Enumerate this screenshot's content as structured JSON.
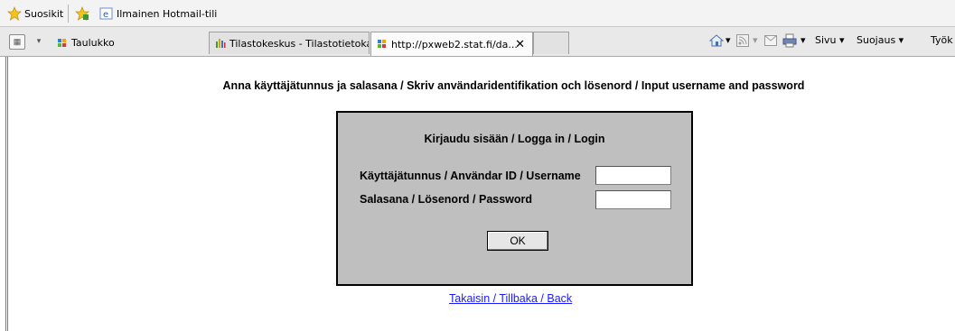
{
  "favorites": {
    "label": "Suosikit",
    "hotmail": "Ilmainen Hotmail-tili"
  },
  "tabs": [
    {
      "label": "Taulukko"
    },
    {
      "label": "Tilastokeskus - Tilastotietoka..."
    },
    {
      "label": "http://pxweb2.stat.fi/da..."
    }
  ],
  "commandbar": {
    "page": "Sivu",
    "safety": "Suojaus",
    "tools": "Työk"
  },
  "page": {
    "heading": "Anna käyttäjätunnus ja salasana / Skriv användaridentifikation och lösenord / Input username and password",
    "login": {
      "title": "Kirjaudu sisään / Logga in / Login",
      "username_label": "Käyttäjätunnus / Användar ID / Username",
      "password_label": "Salasana / Lösenord / Password",
      "ok": "OK"
    },
    "back_link": "Takaisin / Tillbaka / Back"
  }
}
